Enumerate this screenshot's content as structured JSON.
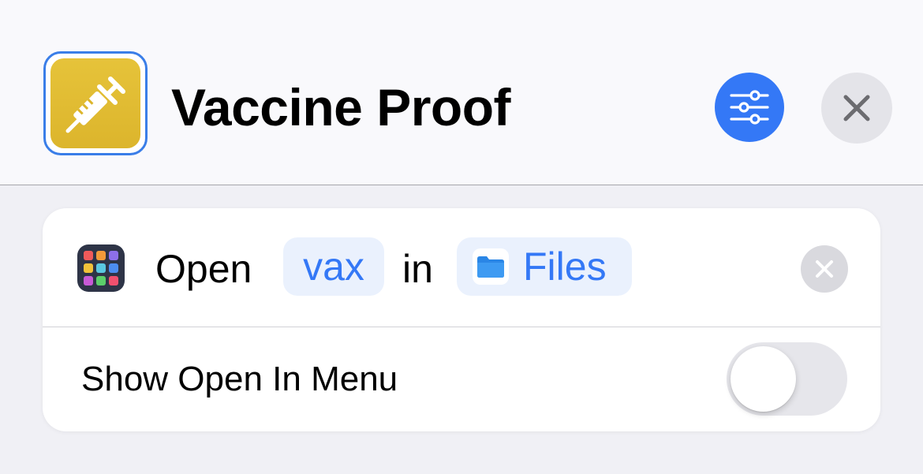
{
  "header": {
    "title": "Vaccine Proof",
    "app_icon": "syringe-icon",
    "settings_icon": "sliders-icon",
    "close_icon": "close-icon"
  },
  "action": {
    "verb": "Open",
    "file_param": "vax",
    "preposition": "in",
    "app_param": "Files",
    "app_param_icon": "folder-icon",
    "action_icon": "app-grid-icon",
    "remove_icon": "remove-icon"
  },
  "options": {
    "show_open_in_menu_label": "Show Open In Menu",
    "show_open_in_menu_enabled": false
  },
  "colors": {
    "accent": "#3478f6",
    "app_icon_yellow": "#e2bd33",
    "token_background": "#eaf1fd"
  }
}
